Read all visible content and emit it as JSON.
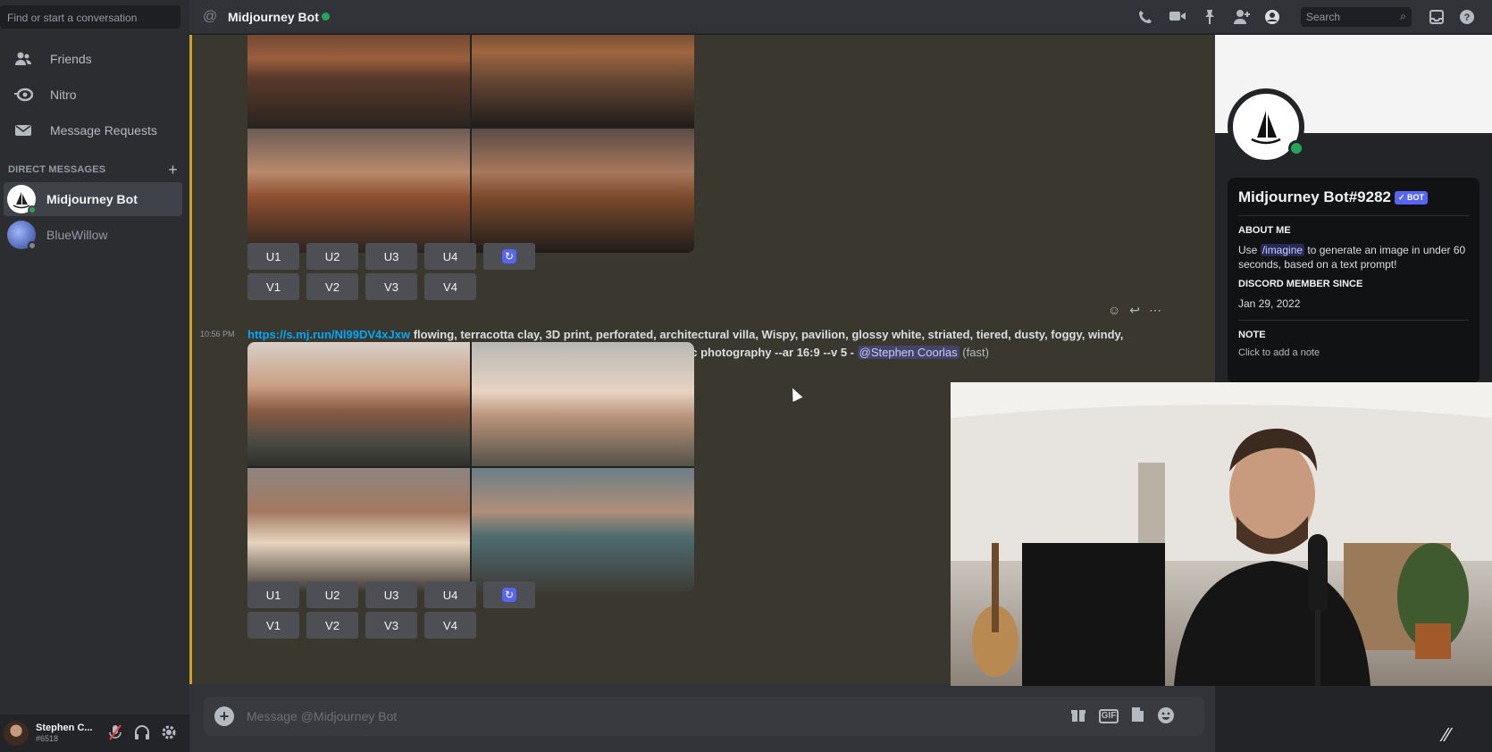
{
  "sidebar": {
    "search_placeholder": "Find or start a conversation",
    "nav": [
      {
        "label": "Friends",
        "icon": "friends-icon"
      },
      {
        "label": "Nitro",
        "icon": "nitro-icon"
      },
      {
        "label": "Message Requests",
        "icon": "mail-icon"
      }
    ],
    "dm_header": "DIRECT MESSAGES",
    "dms": [
      {
        "label": "Midjourney Bot",
        "active": true
      },
      {
        "label": "BlueWillow",
        "active": false
      }
    ],
    "user": {
      "name": "Stephen C...",
      "tag": "#6518"
    }
  },
  "topbar": {
    "title": "Midjourney Bot",
    "search_placeholder": "Search"
  },
  "chat": {
    "upscale_buttons": [
      "U1",
      "U2",
      "U3",
      "U4"
    ],
    "variation_buttons": [
      "V1",
      "V2",
      "V3",
      "V4"
    ],
    "message": {
      "time": "10:56 PM",
      "link": "https://s.mj.run/Nl99DV4xJxw",
      "prompt": "flowing, terracotta clay, 3D print, perforated, architectural villa, Wispy, pavilion, glossy white, striated, tiered, dusty, foggy, windy, sunrise, low light, artificial lighting, cactus, illuminated swimming pool, cinematic photography --ar 16:9 --v 5 -",
      "mention": "@Stephen Coorlas",
      "speed": "(fast)"
    }
  },
  "composer": {
    "placeholder": "Message @Midjourney Bot"
  },
  "profile": {
    "name": "Midjourney Bot#9282",
    "badge": "✓ BOT",
    "about_heading": "ABOUT ME",
    "about_pre": "Use",
    "about_cmd": "/imagine",
    "about_post": "to generate an image in under 60 seconds, based on a text prompt!",
    "member_heading": "DISCORD MEMBER SINCE",
    "member_since": "Jan 29, 2022",
    "note_heading": "NOTE",
    "note_placeholder": "Click to add a note"
  },
  "colors": {
    "accent": "#5865f2",
    "online": "#23a55a",
    "link": "#00a8fc",
    "highlight_bar": "#c9a227"
  }
}
